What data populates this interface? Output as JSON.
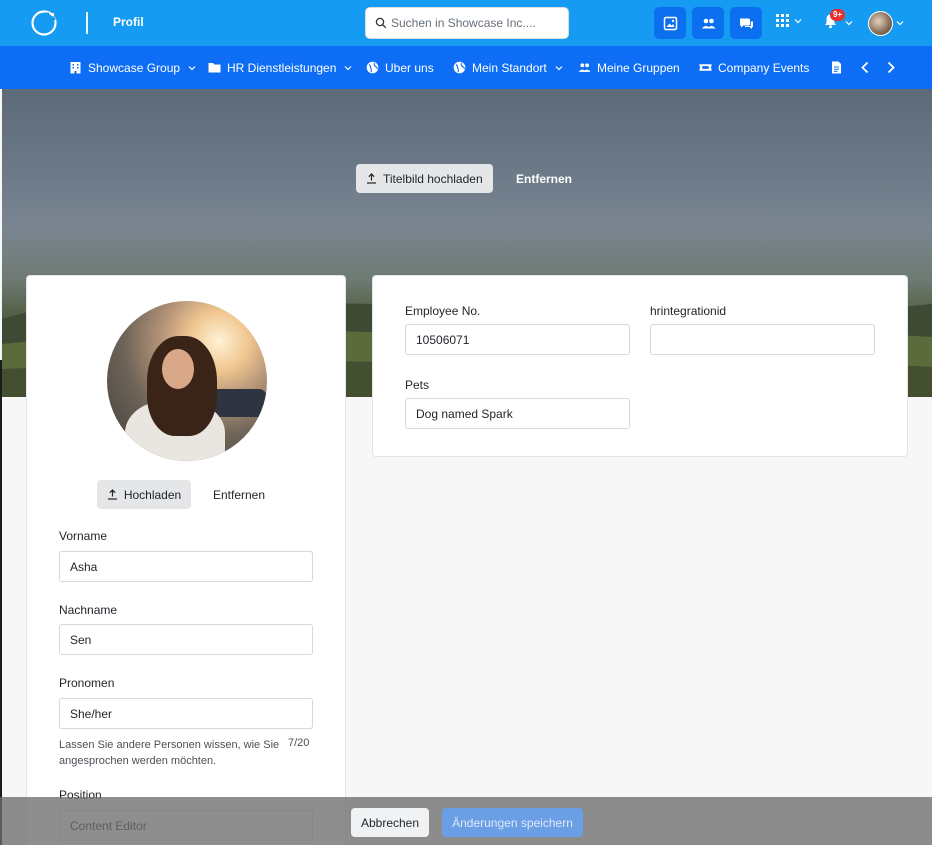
{
  "header": {
    "page_title": "Profil",
    "search_placeholder": "Suchen in Showcase Inc....",
    "notification_badge": "9+",
    "brand_color": "#169bf2",
    "nav_color": "#0d6ef5"
  },
  "nav": {
    "items": [
      {
        "label": "Showcase Group",
        "icon": "building-icon",
        "has_dropdown": true
      },
      {
        "label": "HR Dienstleistungen",
        "icon": "folder-icon",
        "has_dropdown": true
      },
      {
        "label": "Uber uns",
        "icon": "globe-icon",
        "has_dropdown": false
      },
      {
        "label": "Mein Standort",
        "icon": "globe-icon",
        "has_dropdown": true
      },
      {
        "label": "Meine Gruppen",
        "icon": "people-icon",
        "has_dropdown": false
      },
      {
        "label": "Company Events",
        "icon": "ticket-icon",
        "has_dropdown": false
      }
    ]
  },
  "cover": {
    "upload_label": "Titelbild hochladen",
    "remove_label": "Entfernen"
  },
  "profile": {
    "upload_label": "Hochladen",
    "remove_label": "Entfernen",
    "fields": {
      "first_name": {
        "label": "Vorname",
        "value": "Asha"
      },
      "last_name": {
        "label": "Nachname",
        "value": "Sen"
      },
      "pronouns": {
        "label": "Pronomen",
        "value": "She/her",
        "hint": "Lassen Sie andere Personen wissen, wie Sie angesprochen werden möchten.",
        "counter": "7/20"
      },
      "position": {
        "label": "Position",
        "value": "Content Editor"
      }
    }
  },
  "custom_fields": {
    "employee_no": {
      "label": "Employee No.",
      "value": "10506071"
    },
    "hrintegrationid": {
      "label": "hrintegrationid",
      "value": ""
    },
    "pets": {
      "label": "Pets",
      "value": "Dog named Spark"
    }
  },
  "footer": {
    "cancel_label": "Abbrechen",
    "save_label": "Änderungen speichern"
  }
}
